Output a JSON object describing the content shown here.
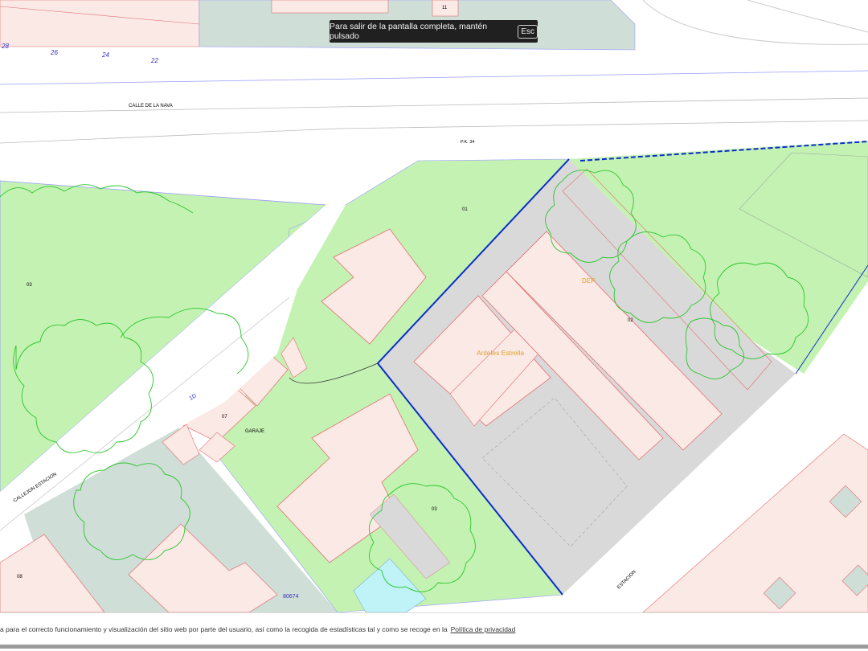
{
  "fullscreen_notice": {
    "text": "Para salir de la pantalla completa, mantén pulsado",
    "key": "Esc"
  },
  "map": {
    "street_labels": {
      "calle_de_la_nava": "CALLE    DE    LA    NAVA",
      "pk": "P.K. 34",
      "callejon_estacion": "CALLEJON   ESTACION",
      "estacion": "ESTACION"
    },
    "parcel_numbers": {
      "n01": "01",
      "n02": "02",
      "n03_left": "03",
      "n03_bottom": "03",
      "n07": "07",
      "n08": "08",
      "n11": "11",
      "n28": "28",
      "n26": "26",
      "n24": "24",
      "n22": "22"
    },
    "building_labels": {
      "garaje": "GARAJE",
      "dep": "DEP",
      "business": "Anteles Estrella"
    },
    "plot_reference": "80674",
    "road_marker": "1D",
    "colors": {
      "grass": "#c4f2b3",
      "building": "#fbe9e6",
      "paved": "#d9d9d9",
      "road_gray": "#cfded7",
      "parcel_border": "#0a2ccc",
      "tree_outline": "#2cc62c",
      "water": "#bff3f8"
    }
  },
  "cookie_bar": {
    "text": "a para el correcto funcionamiento y visualización del sitio web por parte del usuario, así como la recogida de estadísticas tal y como se recoge en la",
    "link": "Política de privacidad"
  }
}
